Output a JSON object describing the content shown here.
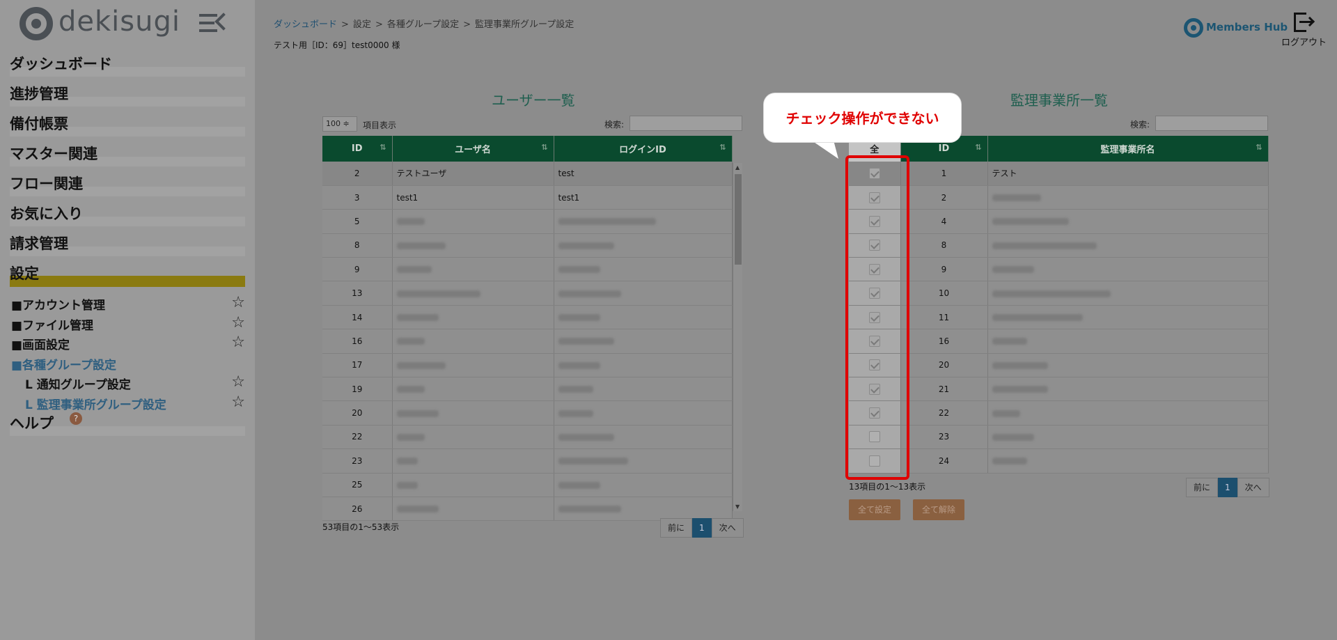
{
  "sidebar": {
    "logo_text": "dekisugi",
    "menu": [
      {
        "label": "ダッシュボード"
      },
      {
        "label": "進捗管理"
      },
      {
        "label": "備付帳票"
      },
      {
        "label": "マスター関連"
      },
      {
        "label": "フロー関連"
      },
      {
        "label": "お気に入り"
      },
      {
        "label": "請求管理"
      },
      {
        "label": "設定"
      }
    ],
    "submenu": [
      {
        "label": "■アカウント管理",
        "star": "☆"
      },
      {
        "label": "■ファイル管理",
        "star": "☆"
      },
      {
        "label": "■画面設定",
        "star": "☆"
      },
      {
        "label": "■各種グループ設定",
        "star": ""
      },
      {
        "label": "L 通知グループ設定",
        "star": "☆"
      },
      {
        "label": "L 監理事業所グループ設定",
        "star": "☆"
      }
    ],
    "help_label": "ヘルプ",
    "help_badge": "?"
  },
  "header": {
    "breadcrumb": [
      "ダッシュボード",
      "設定",
      "各種グループ設定",
      "監理事業所グループ設定"
    ],
    "breadcrumb_sep": ">",
    "tenant": "テスト用［ID：69］test0000 様",
    "brand": "Members Hub",
    "logout": "ログアウト"
  },
  "users": {
    "title": "ユーザー一覧",
    "page_size": "100 ≑",
    "page_size_label": "項目表示",
    "search_label": "検索:",
    "columns": [
      "ID",
      "ユーザ名",
      "ログインID"
    ],
    "rows": [
      {
        "id": "2",
        "name": "テストユーザ",
        "login": "test"
      },
      {
        "id": "3",
        "name": "test1",
        "login": "test1"
      },
      {
        "id": "5",
        "name": "",
        "login": ""
      },
      {
        "id": "8",
        "name": "",
        "login": ""
      },
      {
        "id": "9",
        "name": "",
        "login": ""
      },
      {
        "id": "13",
        "name": "",
        "login": ""
      },
      {
        "id": "14",
        "name": "",
        "login": ""
      },
      {
        "id": "16",
        "name": "",
        "login": ""
      },
      {
        "id": "17",
        "name": "",
        "login": ""
      },
      {
        "id": "19",
        "name": "",
        "login": ""
      },
      {
        "id": "20",
        "name": "",
        "login": ""
      },
      {
        "id": "22",
        "name": "",
        "login": ""
      },
      {
        "id": "23",
        "name": "",
        "login": ""
      },
      {
        "id": "25",
        "name": "",
        "login": ""
      },
      {
        "id": "26",
        "name": "",
        "login": ""
      }
    ],
    "info": "53項目の1～53表示",
    "prev": "前に",
    "page": "1",
    "next": "次へ"
  },
  "offices": {
    "title": "監理事業所一覧",
    "search_label": "検索:",
    "columns": [
      "全",
      "ID",
      "監理事業所名"
    ],
    "rows": [
      {
        "id": "1",
        "name": "テスト",
        "checked": true
      },
      {
        "id": "2",
        "name": "",
        "checked": true
      },
      {
        "id": "4",
        "name": "",
        "checked": true
      },
      {
        "id": "8",
        "name": "",
        "checked": true
      },
      {
        "id": "9",
        "name": "",
        "checked": true
      },
      {
        "id": "10",
        "name": "",
        "checked": true
      },
      {
        "id": "11",
        "name": "",
        "checked": true
      },
      {
        "id": "16",
        "name": "",
        "checked": true
      },
      {
        "id": "20",
        "name": "",
        "checked": true
      },
      {
        "id": "21",
        "name": "",
        "checked": true
      },
      {
        "id": "22",
        "name": "",
        "checked": true
      },
      {
        "id": "23",
        "name": "",
        "checked": false
      },
      {
        "id": "24",
        "name": "",
        "checked": false
      }
    ],
    "info": "13項目の1～13表示",
    "prev": "前に",
    "page": "1",
    "next": "次へ",
    "set_all": "全て設定",
    "clear_all": "全て解除"
  },
  "annotation": {
    "callout_text": "チェック操作ができない",
    "color": "#e00000"
  }
}
